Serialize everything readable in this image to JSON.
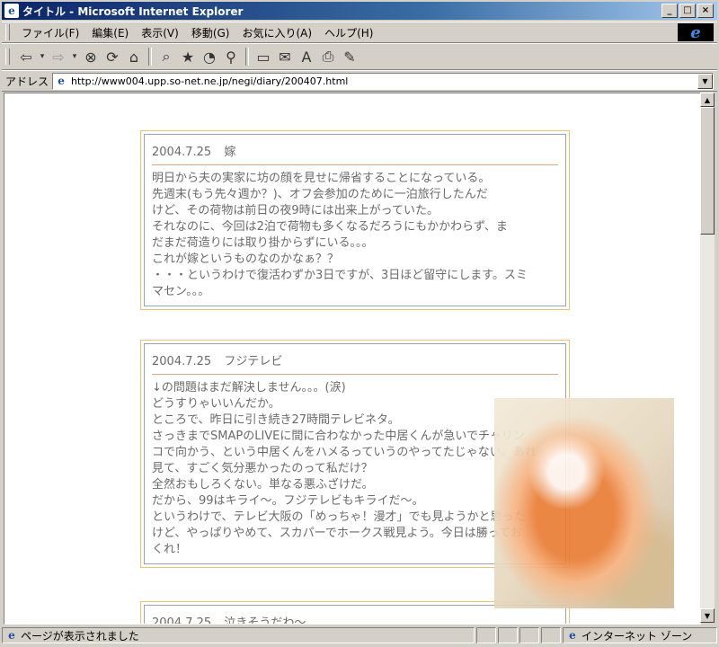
{
  "window": {
    "title": "タイトル - Microsoft Internet Explorer",
    "controls": {
      "minimize": "_",
      "maximize": "□",
      "close": "×"
    }
  },
  "menu": {
    "items": [
      "ファイル(F)",
      "編集(E)",
      "表示(V)",
      "移動(G)",
      "お気に入り(A)",
      "ヘルプ(H)"
    ]
  },
  "toolbar": {
    "icons": [
      "back-icon",
      "forward-icon",
      "stop-icon",
      "refresh-icon",
      "home-icon",
      "search-icon",
      "favorites-icon",
      "history-icon",
      "channels-icon",
      "fullscreen-icon",
      "mail-icon",
      "font-icon",
      "print-icon",
      "edit-icon"
    ]
  },
  "address": {
    "label": "アドレス",
    "url": "http://www004.upp.so-net.ne.jp/negi/diary/200407.html"
  },
  "entries": [
    {
      "date": "2004.7.25",
      "title": "嫁",
      "lines": [
        "明日から夫の実家に坊の顔を見せに帰省することになっている。",
        "先週末(もう先々週か？)、オフ会参加のために一泊旅行したんだ",
        "けど、その荷物は前日の夜9時には出来上がっていた。",
        "それなのに、今回は2泊で荷物も多くなるだろうにもかかわらず、ま",
        "だまだ荷造りには取り掛からずにいる。。。",
        "これが嫁というものなのかなぁ？？",
        "・・・というわけで復活わずか3日ですが、3日ほど留守にします。スミ",
        "マセン。。。"
      ]
    },
    {
      "date": "2004.7.25",
      "title": "フジテレビ",
      "lines": [
        "↓の問題はまだ解決しません。。。(涙)",
        "どうすりゃいいんだか。",
        "ところで、昨日に引き続き27時間テレビネタ。",
        "さっきまでSMAPのLIVEに間に合わなかった中居くんが急いでチャリン",
        "コで向かう、という中居くんをハメるっていうのやってたじゃない。あれ",
        "見て、すごく気分悪かったのって私だけ？",
        "全然おもしろくない。単なる悪ふざけだ。",
        "だから、99はキライ～。フジテレビもキライだ～。",
        "というわけで、テレビ大阪の「めっちゃ！漫才」でも見ようかと思った",
        "けど、やっぱりやめて、スカパーでホークス戦見よう。今日は勝ってお",
        "くれ！"
      ]
    },
    {
      "date": "2004.7.25",
      "title": "泣きそうだわ～",
      "lines": []
    }
  ],
  "status": {
    "text": "ページが表示されました",
    "zone": "インターネット ゾーン"
  },
  "colors": {
    "title_bar": "#0a246a",
    "entry_border": "#f2c26a",
    "entry_text": "#6a6a6a",
    "entry_rule": "#e8a27c"
  }
}
